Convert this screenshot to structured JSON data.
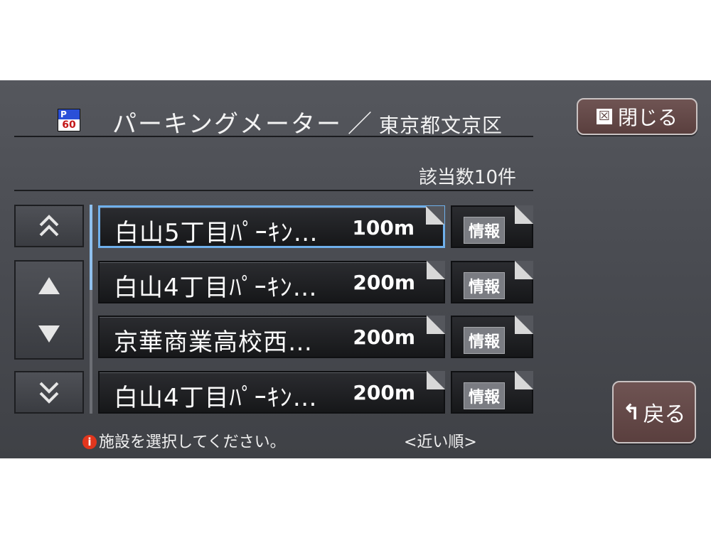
{
  "header": {
    "icon_top": "P",
    "icon_bottom": "60",
    "title": "パーキングメーター",
    "separator": "／",
    "area": "東京都文京区",
    "close_label": "閉じる",
    "close_icon": "☒"
  },
  "result": {
    "count_text": "該当数10件"
  },
  "scroll": {
    "page_up_icon": "chevrons-up-icon",
    "up_icon": "triangle-up-icon",
    "down_icon": "triangle-down-icon",
    "page_down_icon": "chevrons-down-icon"
  },
  "items": [
    {
      "name": "白山5丁目ﾊﾟｰｷﾝ…",
      "distance": "100m",
      "info": "情報",
      "selected": true
    },
    {
      "name": "白山4丁目ﾊﾟｰｷﾝ…",
      "distance": "200m",
      "info": "情報",
      "selected": false
    },
    {
      "name": "京華商業高校西…",
      "distance": "200m",
      "info": "情報",
      "selected": false
    },
    {
      "name": "白山4丁目ﾊﾟｰｷﾝ…",
      "distance": "200m",
      "info": "情報",
      "selected": false
    }
  ],
  "footer": {
    "status": "施設を選択してください。",
    "sort": "<近い順>",
    "back_label": "戻る"
  },
  "colors": {
    "accent": "#6fb0ec",
    "button": "#5a3f3e",
    "info_icon": "#e2361d"
  }
}
